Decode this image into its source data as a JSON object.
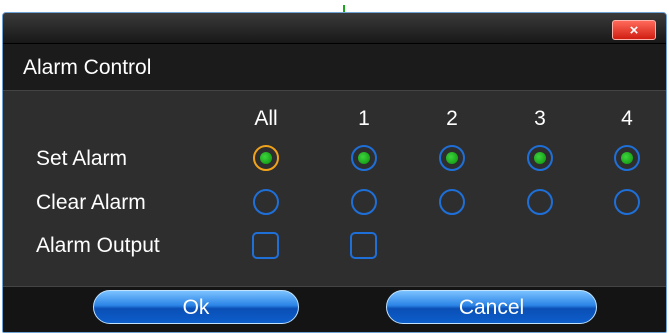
{
  "dialog": {
    "title": "Alarm Control",
    "close_glyph": "×"
  },
  "columns": [
    "All",
    "1",
    "2",
    "3",
    "4"
  ],
  "rows": {
    "set_alarm": "Set Alarm",
    "clear_alarm": "Clear Alarm",
    "alarm_output": "Alarm Output"
  },
  "state": {
    "set_alarm": [
      true,
      true,
      true,
      true,
      true
    ],
    "clear_alarm": [
      false,
      false,
      false,
      false,
      false
    ],
    "alarm_output": [
      false,
      false
    ]
  },
  "buttons": {
    "ok": "Ok",
    "cancel": "Cancel"
  },
  "colors": {
    "dialog_bg": "#2f2f2f",
    "accent_blue": "#1f6fd8",
    "focus_orange": "#f0a21a",
    "checked_green": "#19b319",
    "close_red": "#e2352a"
  },
  "icons": {
    "close": "close-icon"
  }
}
